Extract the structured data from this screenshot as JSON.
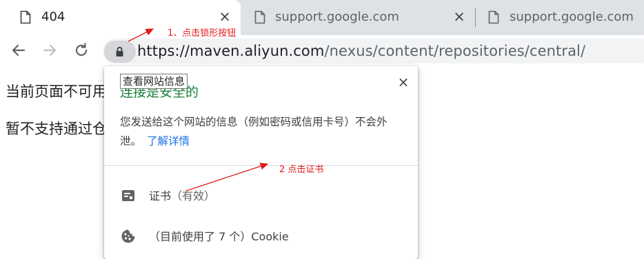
{
  "tabs": [
    {
      "title": "404",
      "icon": "document-icon",
      "close": "×"
    },
    {
      "title": "support.google.com",
      "icon": "document-icon",
      "close": "×"
    },
    {
      "title": "support.google.com",
      "icon": "document-icon"
    }
  ],
  "toolbar": {
    "back": "back-arrow-icon",
    "forward": "forward-arrow-icon",
    "reload": "reload-icon",
    "url_host": "https://maven.aliyun.com",
    "url_path": "/nexus/content/repositories/central/"
  },
  "page": {
    "line1": "当前页面不可用",
    "line2": "暂不支持通过仓库地址浏览所有可用仓库及仓库内容，请"
  },
  "annotations": {
    "step1": "1、点击锁形按钮",
    "step2": "2 点击证书",
    "color": "#e01b1b"
  },
  "popup": {
    "tooltip": "查看网站信息",
    "title": "连接是安全的",
    "close": "×",
    "desc": "您发送给这个网站的信息（例如密码或信用卡号）不会外泄。",
    "learn_more": "了解详情",
    "certificate_label": "证书",
    "certificate_status": "（有效）",
    "cookie_label": "（目前使用了 7 个）Cookie",
    "title_color": "#188038",
    "link_color": "#1a73e8"
  }
}
